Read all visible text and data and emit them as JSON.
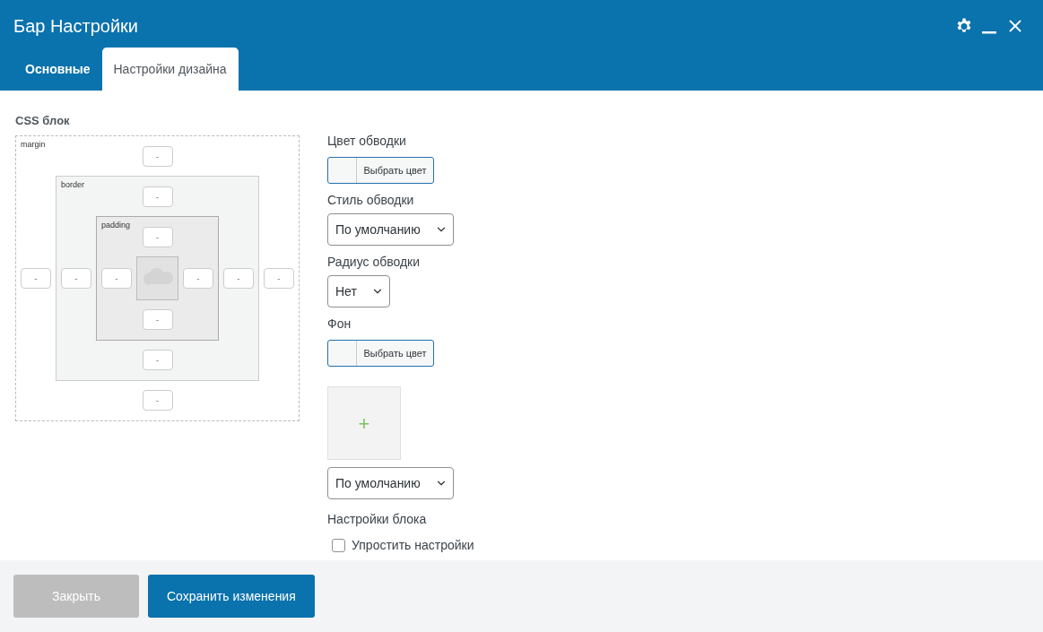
{
  "window": {
    "title": "Бар Настройки"
  },
  "tabs": [
    {
      "label": "Основные",
      "selected": false
    },
    {
      "label": "Настройки дизайна",
      "selected": true
    }
  ],
  "css_block": {
    "title": "CSS блок",
    "layer": {
      "label": "margin",
      "top_placeholder": "-",
      "left_placeholder": "-",
      "inner": {
        "label": "border",
        "top_placeholder": "-",
        "left_placeholder": "-",
        "inner": {
          "label": "padding",
          "top_placeholder": "-",
          "left_placeholder": "-",
          "right_placeholder": "-",
          "bottom_placeholder": "-"
        },
        "right_placeholder": "-",
        "bottom_placeholder": "-"
      },
      "right_placeholder": "-",
      "bottom_placeholder": "-"
    }
  },
  "fields": [
    {
      "kind": "color",
      "label": "Цвет обводки",
      "button": "Выбрать цвет"
    },
    {
      "kind": "select",
      "label": "Стиль обводки",
      "value": "По умолчанию"
    },
    {
      "kind": "select",
      "label": "Радиус обводки",
      "value": "Нет"
    },
    {
      "kind": "color",
      "label": "Фон",
      "button": "Выбрать цвет"
    },
    {
      "kind": "image",
      "plus": "+"
    },
    {
      "kind": "select",
      "value": "По умолчанию"
    },
    {
      "kind": "heading",
      "label": "Настройки блока"
    },
    {
      "kind": "checkbox",
      "label": "Упростить настройки",
      "checked": false
    }
  ],
  "buttons": [
    {
      "label": "Закрыть",
      "disabled": true
    },
    {
      "label": "Сохранить изменения",
      "disabled": false
    }
  ]
}
